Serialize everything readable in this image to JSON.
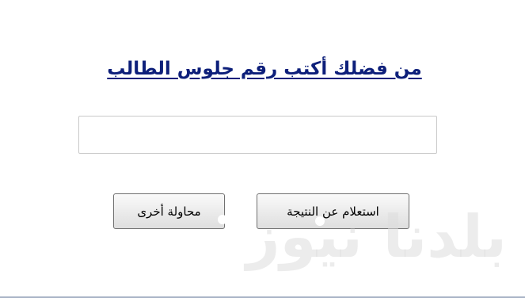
{
  "form": {
    "heading": "من فضلك أكتب رقم جلوس الطالب",
    "seat_number": {
      "value": "",
      "placeholder": ""
    },
    "query_button_label": "استعلام عن النتيجة",
    "retry_button_label": "محاولة أخرى"
  },
  "watermark": {
    "text": "بلدنا نيوز"
  },
  "colors": {
    "heading": "#0d1f7a",
    "input_border": "#c9c9c9",
    "button_border": "#707070",
    "bottom_line": "#a9b4c6"
  }
}
